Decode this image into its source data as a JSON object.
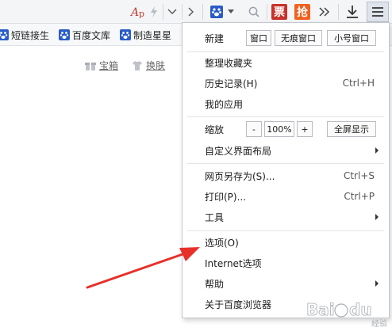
{
  "toolbar": {
    "icons": [
      "reading-mode-icon",
      "lightning-icon",
      "chevron-down-icon",
      "chevron-right-icon",
      "baidu-paw-icon",
      "search-icon",
      "ticket-icon",
      "grab-ticket-icon",
      "overflow-icon",
      "download-icon",
      "menu-icon"
    ],
    "ticket_char": "票",
    "grab_char": "抢",
    "accent_ticket": "#c8322a",
    "accent_grab": "#f0611f"
  },
  "bookmarks": {
    "items": [
      {
        "label": "短链接生"
      },
      {
        "label": "百度文库"
      },
      {
        "label": "制造星星"
      }
    ]
  },
  "page": {
    "links": [
      {
        "label": "宝箱",
        "icon": "gift-icon"
      },
      {
        "label": "换肤",
        "icon": "shirt-icon"
      }
    ]
  },
  "menu": {
    "new_label": "新建",
    "new_buttons": [
      "窗口",
      "无痕窗口",
      "小号窗口"
    ],
    "organize_bookmarks": "整理收藏夹",
    "history": {
      "label": "历史记录(H)",
      "shortcut": "Ctrl+H"
    },
    "my_apps": "我的应用",
    "zoom": {
      "label": "缩放",
      "minus": "-",
      "value": "100%",
      "plus": "+",
      "fullscreen": "全屏显示"
    },
    "customize_layout": "自定义界面布局",
    "save_as": {
      "label": "网页另存为(S)...",
      "shortcut": "Ctrl+S"
    },
    "print": {
      "label": "打印(P)...",
      "shortcut": "Ctrl+P"
    },
    "tools": "工具",
    "options": "选项(O)",
    "internet_options": "Internet选项",
    "help": "帮助",
    "about": "关于百度浏览器"
  },
  "annotation": {
    "arrow_color": "#e8302a"
  },
  "watermark": {
    "text": "Baidu",
    "subtext": "经验"
  }
}
